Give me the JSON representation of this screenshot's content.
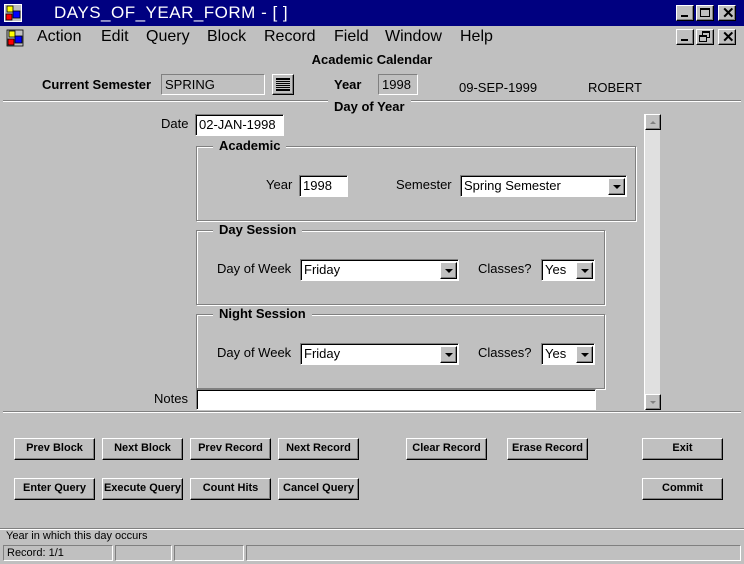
{
  "window": {
    "title": "DAYS_OF_YEAR_FORM - [ ]"
  },
  "menu": [
    "Action",
    "Edit",
    "Query",
    "Block",
    "Record",
    "Field",
    "Window",
    "Help"
  ],
  "form_title": "Academic Calendar",
  "header": {
    "current_semester_label": "Current Semester",
    "current_semester_value": "SPRING",
    "year_label": "Year",
    "year_value": "1998",
    "date_display": "09-SEP-1999",
    "user_display": "ROBERT"
  },
  "day_of_year": {
    "section_title": "Day of Year",
    "date_label": "Date",
    "date_value": "02-JAN-1998",
    "academic": {
      "title": "Academic",
      "year_label": "Year",
      "year_value": "1998",
      "semester_label": "Semester",
      "semester_value": "Spring Semester"
    },
    "day_session": {
      "title": "Day Session",
      "dow_label": "Day of Week",
      "dow_value": "Friday",
      "classes_label": "Classes?",
      "classes_value": "Yes"
    },
    "night_session": {
      "title": "Night Session",
      "dow_label": "Day of Week",
      "dow_value": "Friday",
      "classes_label": "Classes?",
      "classes_value": "Yes"
    },
    "notes_label": "Notes",
    "notes_value": ""
  },
  "buttons": {
    "prev_block": "Prev Block",
    "next_block": "Next Block",
    "prev_record": "Prev Record",
    "next_record": "Next Record",
    "clear_record": "Clear Record",
    "erase_record": "Erase Record",
    "exit": "Exit",
    "enter_query": "Enter Query",
    "execute_query": "Execute Query",
    "count_hits": "Count Hits",
    "cancel_query": "Cancel Query",
    "commit": "Commit"
  },
  "status": {
    "hint": "Year in which this day occurs",
    "record": "Record: 1/1"
  },
  "colors": {
    "title_bar": "#000080",
    "face": "#c0c0c0",
    "field": "#ffffff"
  }
}
